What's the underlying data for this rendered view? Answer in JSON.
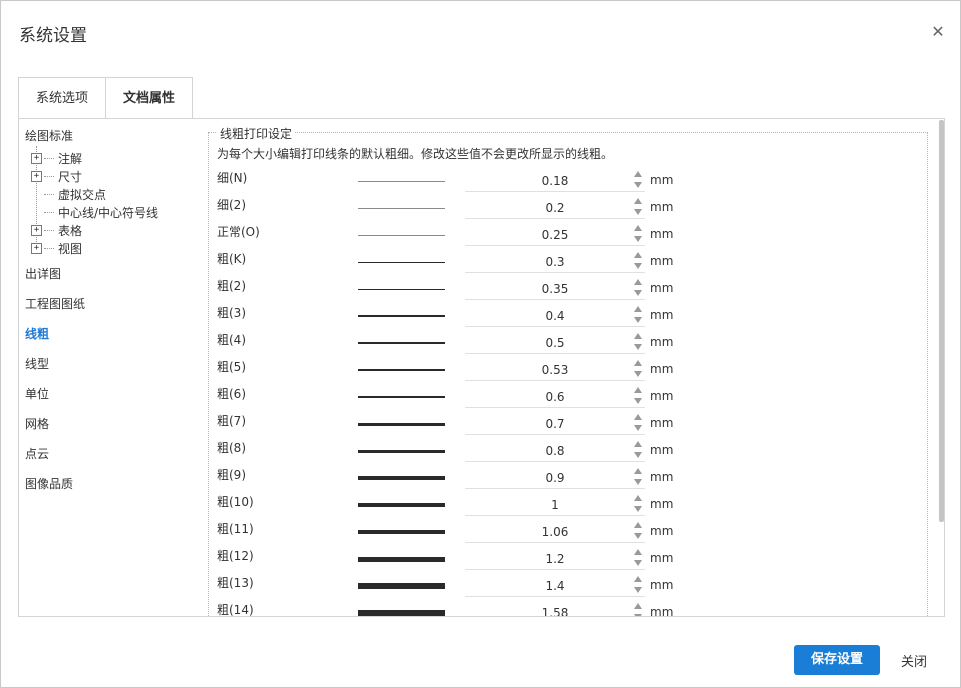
{
  "dialog": {
    "title": "系统设置",
    "close_icon": "close-icon"
  },
  "tabs": [
    {
      "label": "系统选项",
      "active": false
    },
    {
      "label": "文档属性",
      "active": true
    }
  ],
  "tree": {
    "root": "绘图标准",
    "nodes": [
      {
        "label": "注解",
        "expandable": true
      },
      {
        "label": "尺寸",
        "expandable": true
      },
      {
        "label": "虚拟交点",
        "expandable": false
      },
      {
        "label": "中心线/中心符号线",
        "expandable": false
      },
      {
        "label": "表格",
        "expandable": true
      },
      {
        "label": "视图",
        "expandable": true
      }
    ]
  },
  "categories": [
    "出详图",
    "工程图图纸",
    "线粗",
    "线型",
    "单位",
    "网格",
    "点云",
    "图像品质"
  ],
  "active_category": "线粗",
  "section": {
    "legend": "线粗打印设定",
    "description": "为每个大小编辑打印线条的默认粗细。修改这些值不会更改所显示的线粗。",
    "unit": "mm",
    "rows": [
      {
        "label": "细(N)",
        "value": "0.18"
      },
      {
        "label": "细(2)",
        "value": "0.2"
      },
      {
        "label": "正常(O)",
        "value": "0.25"
      },
      {
        "label": "粗(K)",
        "value": "0.3"
      },
      {
        "label": "粗(2)",
        "value": "0.35"
      },
      {
        "label": "粗(3)",
        "value": "0.4"
      },
      {
        "label": "粗(4)",
        "value": "0.5"
      },
      {
        "label": "粗(5)",
        "value": "0.53"
      },
      {
        "label": "粗(6)",
        "value": "0.6"
      },
      {
        "label": "粗(7)",
        "value": "0.7"
      },
      {
        "label": "粗(8)",
        "value": "0.8"
      },
      {
        "label": "粗(9)",
        "value": "0.9"
      },
      {
        "label": "粗(10)",
        "value": "1"
      },
      {
        "label": "粗(11)",
        "value": "1.06"
      },
      {
        "label": "粗(12)",
        "value": "1.2"
      },
      {
        "label": "粗(13)",
        "value": "1.4"
      },
      {
        "label": "粗(14)",
        "value": "1.58"
      }
    ]
  },
  "footer": {
    "save_label": "保存设置",
    "close_label": "关闭"
  },
  "colors": {
    "accent": "#1a7ed6",
    "border": "#d4d4d4"
  }
}
